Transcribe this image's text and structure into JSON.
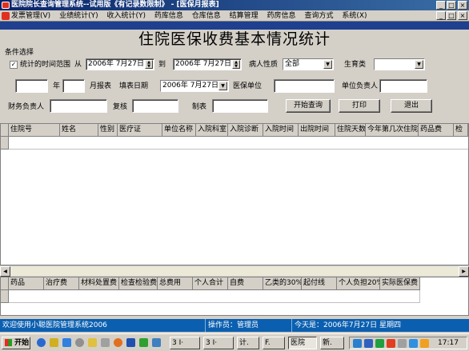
{
  "window": {
    "title": "医院院长查询管理系统--试用版《有记录数限制》 - [医保月报表]",
    "min": "_",
    "max": "□",
    "close": "×"
  },
  "menu": [
    "发票管理(V)",
    "业绩统计(Y)",
    "收入统计(Y)",
    "药库信息",
    "仓库信息",
    "结算管理",
    "药房信息",
    "查询方式",
    "系统(X)"
  ],
  "heading": "住院医保收费基本情况统计",
  "form": {
    "group_label": "条件选择",
    "range_check_label": "统计的时间范围",
    "from_label": "从",
    "from_date": "2006年 7月27日",
    "to_label": "到",
    "to_date": "2006年 7月27日",
    "patient_type_label": "病人性质",
    "patient_type_value": "全部",
    "fertility_label": "生育类",
    "fertility_value": "",
    "year_value": "",
    "year_label": "年",
    "month_value": "",
    "month_label": "月报表",
    "fill_date_label": "填表日期",
    "fill_date_value": "2006年 7月27日",
    "insurance_unit_label": "医保单位",
    "insurance_unit_value": "",
    "unit_head_label": "单位负责人",
    "unit_head_value": "",
    "finance_head_label": "财务负责人",
    "finance_head_value": "",
    "reviewer_label": "复核",
    "reviewer_value": "",
    "preparer_label": "制表",
    "preparer_value": "",
    "query_button": "开始查询",
    "print_button": "打印",
    "exit_button": "退出"
  },
  "main_grid": {
    "columns": [
      "住院号",
      "姓名",
      "性别",
      "医疗证",
      "单位名称",
      "入院科室",
      "入院诊断",
      "入院时间",
      "出院时间",
      "住院天数",
      "今年第几次住院",
      "药品费",
      "检"
    ]
  },
  "summary_grid": {
    "columns": [
      "药品",
      "治疗费",
      "材料处置费",
      "检查检验费",
      "总费用",
      "个人合计",
      "自费",
      "乙类的30%",
      "起付线",
      "个人负担20%",
      "实际医保费"
    ]
  },
  "status": {
    "welcome": "欢迎使用小聪医院管理系统2006",
    "operator": "操作员：管理员",
    "today": "今天是：2006年7月27日 星期四"
  },
  "taskbar": {
    "start": "开始",
    "tasks": [
      "3 I·",
      "3 I·",
      "计.",
      "F.",
      "医院",
      "新."
    ],
    "clock": "17:17"
  },
  "colors": {
    "title_bar": "#0a246a",
    "status_bar": "#0a5fb0",
    "grid_bg": "#ffffff"
  }
}
